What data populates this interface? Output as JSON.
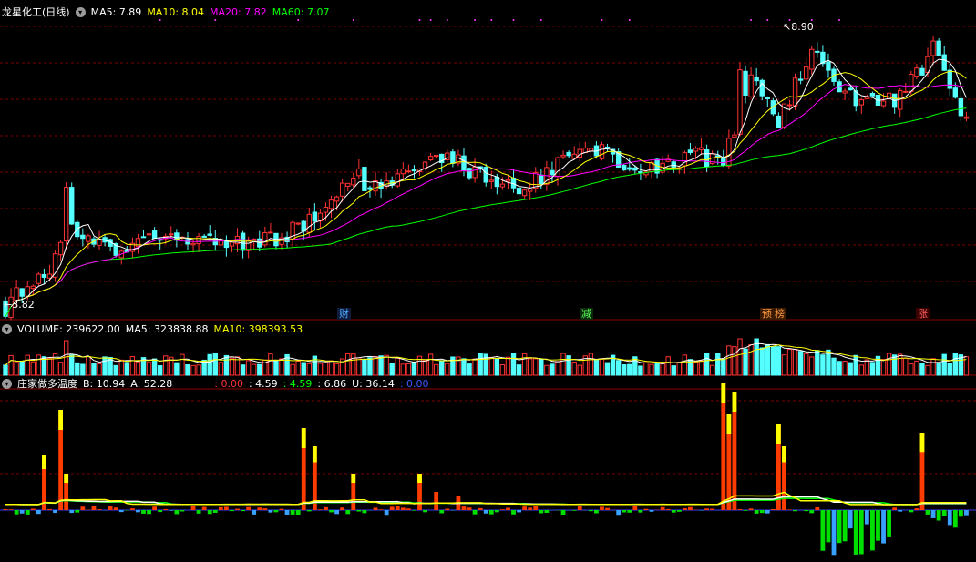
{
  "colors": {
    "bg": "#000000",
    "up": "#ff3232",
    "down": "#54ffff",
    "ma5": "#ffffff",
    "ma10": "#ffff00",
    "ma20": "#ff00ff",
    "ma60": "#00ff00",
    "grid": "#7a0000",
    "redBar": "#ff3c00",
    "yellowCap": "#ffff00",
    "green": "#00e000",
    "blue": "#3aa0ff"
  },
  "price_panel": {
    "title": "龙星化工(日线)",
    "ma5": "MA5: 7.89",
    "ma10": "MA10: 8.04",
    "ma20": "MA20: 7.82",
    "ma60": "MA60: 7.07",
    "high_label": "8.90",
    "low_label": "3.82",
    "events": [
      "财",
      "减",
      "预",
      "榜",
      "涨"
    ]
  },
  "volume_panel": {
    "vol": "VOLUME: 239622.00",
    "ma5": "MA5: 323838.88",
    "ma10": "MA10: 398393.53"
  },
  "indicator_panel": {
    "title": "庄家做多温度",
    "b": "B: 10.94",
    "a": "A: 52.28",
    "v1": ": 0.00",
    "v2": ": 4.59",
    "v3": ": 4.59",
    "v4": ": 6.86",
    "v5": "U: 36.14",
    "v6": ": 0.00"
  },
  "chart_data": [
    {
      "type": "candlestick",
      "title": "龙星化工(日线)",
      "series_names": [
        "MA5",
        "MA10",
        "MA20",
        "MA60"
      ],
      "y_range": [
        3.82,
        8.9
      ],
      "price_high": 8.9,
      "price_low": 3.82,
      "ma_values": {
        "MA5": 7.89,
        "MA10": 8.04,
        "MA20": 7.82,
        "MA60": 7.07
      }
    },
    {
      "type": "bar",
      "title": "VOLUME",
      "values": {
        "VOLUME": 239622.0,
        "MA5": 323838.88,
        "MA10": 398393.53
      }
    },
    {
      "type": "bar",
      "title": "庄家做多温度",
      "values": {
        "B": 10.94,
        "A": 52.28,
        "U": 36.14
      }
    }
  ]
}
